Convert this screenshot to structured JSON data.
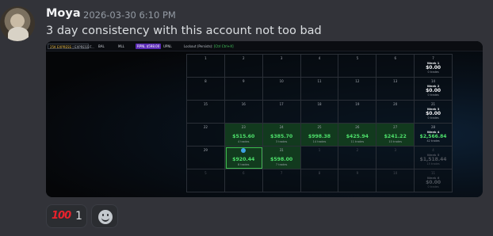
{
  "message": {
    "author": "Moya",
    "timestamp": "2026-03-30 6:10 PM",
    "content": "3 day consistency with this account not too bad"
  },
  "screenshot": {
    "toolbar": {
      "account_name": "25K EXPRESS",
      "account_suffix": "| EXPRESS F...",
      "bal_label": "BAL",
      "mll_label": "MLL",
      "rpnl_label": "RPNL",
      "rpnl_value": "$598.00",
      "upnl_label": "UPNL",
      "lockout_label": "Lockout (Persists):",
      "lockout_value": "[Ctrl Ctrl+X]"
    },
    "calendar": [
      [
        {
          "d": "1"
        },
        {
          "d": "2"
        },
        {
          "d": "3"
        },
        {
          "d": "4"
        },
        {
          "d": "5"
        },
        {
          "d": "6"
        },
        {
          "d": "7",
          "week": "Week 1",
          "wval": "$0.00",
          "wtr": "0 trades"
        }
      ],
      [
        {
          "d": "8"
        },
        {
          "d": "9"
        },
        {
          "d": "10"
        },
        {
          "d": "11"
        },
        {
          "d": "12"
        },
        {
          "d": "13"
        },
        {
          "d": "14",
          "week": "Week 2",
          "wval": "$0.00",
          "wtr": "0 trades"
        }
      ],
      [
        {
          "d": "15"
        },
        {
          "d": "16"
        },
        {
          "d": "17"
        },
        {
          "d": "18"
        },
        {
          "d": "19"
        },
        {
          "d": "20"
        },
        {
          "d": "21",
          "week": "Week 3",
          "wval": "$0.00",
          "wtr": "0 trades"
        }
      ],
      [
        {
          "d": "22"
        },
        {
          "d": "23",
          "pnl": "$515.60",
          "tr": "4 trades",
          "green": true
        },
        {
          "d": "24",
          "pnl": "$385.70",
          "tr": "3 trades",
          "green": true
        },
        {
          "d": "25",
          "pnl": "$998.38",
          "tr": "14 trades",
          "green": true
        },
        {
          "d": "26",
          "pnl": "$425.94",
          "tr": "11 trades",
          "green": true
        },
        {
          "d": "27",
          "pnl": "$241.22",
          "tr": "10 trades",
          "green": true
        },
        {
          "d": "28",
          "week": "Week 4",
          "wval": "$2,566.84",
          "wtr": "42 trades",
          "wgreen": true
        }
      ],
      [
        {
          "d": "29"
        },
        {
          "d": "30",
          "pnl": "$920.44",
          "tr": "8 trades",
          "green": true,
          "highlight": true,
          "badge": true
        },
        {
          "d": "31",
          "pnl": "$598.00",
          "tr": "7 trades",
          "green": true
        },
        {
          "d": "1",
          "dim": true
        },
        {
          "d": "2",
          "dim": true
        },
        {
          "d": "3",
          "dim": true
        },
        {
          "d": "4",
          "dim": true,
          "week": "Week 5",
          "wval": "$1,518.44",
          "wtr": "15 trades"
        }
      ],
      [
        {
          "d": "5",
          "dim": true
        },
        {
          "d": "6",
          "dim": true
        },
        {
          "d": "7",
          "dim": true
        },
        {
          "d": "8",
          "dim": true
        },
        {
          "d": "9",
          "dim": true
        },
        {
          "d": "10",
          "dim": true
        },
        {
          "d": "11",
          "dim": true,
          "week": "Week 6",
          "wval": "$0.00",
          "wtr": "0 trades"
        }
      ]
    ]
  },
  "reactions": [
    {
      "emoji_name": "hundred-points-emoji",
      "emoji": "100",
      "count": "1"
    }
  ],
  "add_reaction_icon": "smile-add-reaction-icon"
}
